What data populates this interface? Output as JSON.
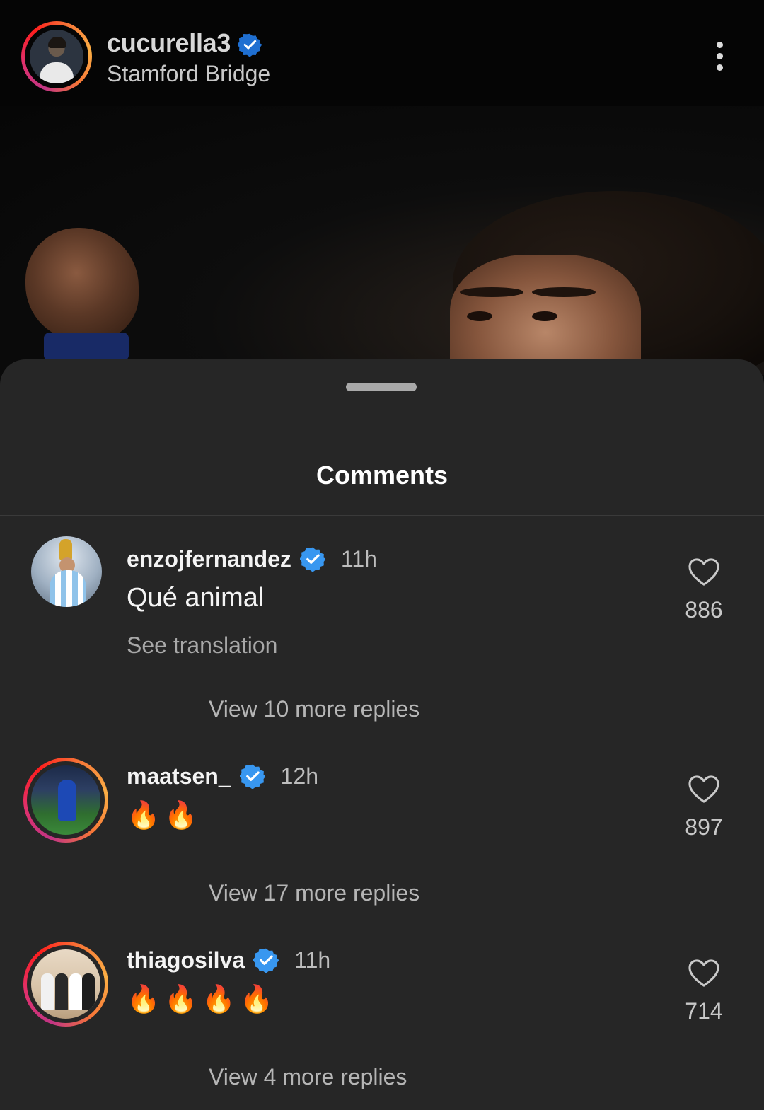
{
  "post": {
    "username": "cucurella3",
    "location": "Stamford Bridge"
  },
  "sheet": {
    "title": "Comments"
  },
  "comments": [
    {
      "username": "enzojfernandez",
      "time": "11h",
      "text": "Qué animal",
      "translate_label": "See translation",
      "likes": "886",
      "replies_label": "View 10 more replies"
    },
    {
      "username": "maatsen_",
      "time": "12h",
      "text": "🔥🔥",
      "likes": "897",
      "replies_label": "View 17 more replies"
    },
    {
      "username": "thiagosilva",
      "time": "11h",
      "text": "🔥🔥🔥🔥",
      "likes": "714",
      "replies_label": "View 4 more replies"
    }
  ],
  "colors": {
    "verified": "#3897f0",
    "sheet_background": "#262626",
    "header_background": "#050505"
  },
  "icons": [
    "verified-badge-icon",
    "more-options-icon",
    "heart-icon"
  ]
}
